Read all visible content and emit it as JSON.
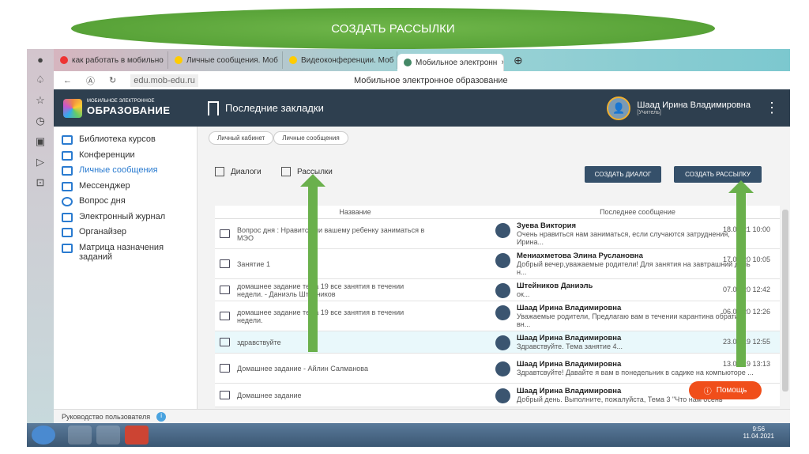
{
  "banner": "СОЗДАТЬ РАССЫЛКИ",
  "browser": {
    "tabs": [
      "как работать в мобильно",
      "Личные сообщения. Моб",
      "Видеоконференции. Моб",
      "Мобильное электронн"
    ],
    "url": "edu.mob-edu.ru",
    "page_title": "Мобильное электронное образование"
  },
  "header": {
    "logo_small": "МОБИЛЬНОЕ ЭЛЕКТРОННОЕ",
    "logo_big": "ОБРАЗОВАНИЕ",
    "bookmarks": "Последние закладки",
    "user_name": "Шаад Ирина Владимировна",
    "user_role": "[Учитель]"
  },
  "sidebar": [
    "Библиотека курсов",
    "Конференции",
    "Личные сообщения",
    "Мессенджер",
    "Вопрос дня",
    "Электронный журнал",
    "Органайзер",
    "Матрица назначения заданий"
  ],
  "breadcrumb": [
    "Личный кабинет",
    "Личные сообщения"
  ],
  "filters": {
    "dialogs": "Диалоги",
    "mailings": "Рассылки"
  },
  "buttons": {
    "create_dialog": "СОЗДАТЬ ДИАЛОГ",
    "create_mailing": "СОЗДАТЬ РАССЫЛКУ",
    "help": "Помощь"
  },
  "table": {
    "headers": [
      "Название",
      "Последнее сообщение"
    ],
    "rows": [
      {
        "title": "Вопрос дня : Нравится ли вашему ребенку заниматься в МЭО",
        "icon": "chat",
        "author": "Зуева Виктория",
        "msg": "Очень нравиться нам заниматься, если случаются затруднения, Ирина...",
        "date": "18.03.21 10:00"
      },
      {
        "title": "Занятие 1",
        "icon": "chat",
        "author": "Мениахметова Элина Руслановна",
        "msg": "Добрый вечер,уважаемые родители! Для занятия на завтрашний день н...",
        "date": "17.05.20 10:05"
      },
      {
        "title": "домашнее задание тема 19 все занятия в течении недели. - Даниэль Штейников",
        "icon": "chat",
        "author": "Штейников Даниэль",
        "msg": "ок...",
        "date": "07.04.20 12:42"
      },
      {
        "title": "домашнее задание тема 19 все занятия в течении недели.",
        "icon": "mail",
        "author": "Шаад Ирина Владимировна",
        "msg": "Уважаемые родители, Предлагаю вам в течении карантина обратить вн...",
        "date": "06.04.20 12:26"
      },
      {
        "title": "здравствуйте",
        "icon": "chat",
        "author": "Шаад Ирина Владимировна",
        "msg": "Здравствуйте. Тема занятие 4...",
        "date": "23.09.19 12:55"
      },
      {
        "title": "Домашнее задание - Айлин Салманова",
        "icon": "chat",
        "author": "Шаад Ирина Владимировна",
        "msg": "Здравтсвуйте! Давайте я вам в понедельник в садике на компьюторе ...",
        "date": "13.09.19 13:13"
      },
      {
        "title": "Домашнее задание",
        "icon": "mail",
        "author": "Шаад Ирина Владимировна",
        "msg": "Добрый день. Выполните, пожалуйста, Тема 3 \"Что нам осень",
        "date": ""
      }
    ]
  },
  "footer": "Руководство пользователя",
  "taskbar": {
    "time": "9:56",
    "date": "11.04.2021"
  }
}
